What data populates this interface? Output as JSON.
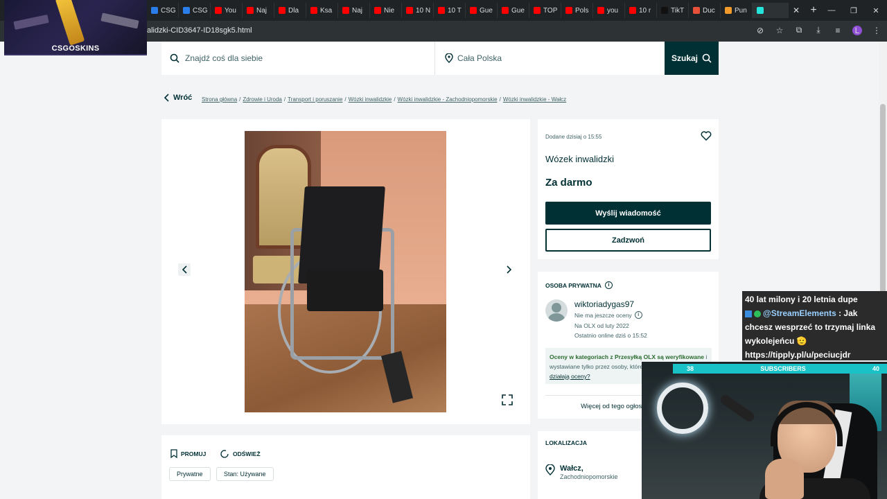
{
  "browser": {
    "tabs": [
      {
        "label": "CSG",
        "color": "#2b7de9"
      },
      {
        "label": "CSG",
        "color": "#2b7de9"
      },
      {
        "label": "You",
        "color": "#ff0000"
      },
      {
        "label": "Naj",
        "color": "#ff0000"
      },
      {
        "label": "Dla",
        "color": "#ff0000"
      },
      {
        "label": "Ksa",
        "color": "#ff0000"
      },
      {
        "label": "Naj",
        "color": "#ff0000"
      },
      {
        "label": "Nie",
        "color": "#ff0000"
      },
      {
        "label": "10 N",
        "color": "#ff0000"
      },
      {
        "label": "10 T",
        "color": "#ff0000"
      },
      {
        "label": "Gue",
        "color": "#ff0000"
      },
      {
        "label": "Gue",
        "color": "#ff0000"
      },
      {
        "label": "TOP",
        "color": "#ff0000"
      },
      {
        "label": "Pols",
        "color": "#ff0000"
      },
      {
        "label": "you",
        "color": "#ff0000"
      },
      {
        "label": "10 r",
        "color": "#ff0000"
      },
      {
        "label": "TikT",
        "color": "#111111"
      },
      {
        "label": "Duc",
        "color": "#e8503a"
      },
      {
        "label": "Pun",
        "color": "#f29b2b"
      },
      {
        "label": "",
        "color": "#23e5db"
      }
    ],
    "close_tab": "✕",
    "new_tab": "+",
    "url": "alidzki-CID3647-ID18sgk5.html",
    "profile_initial": "L",
    "window": {
      "minimize": "—",
      "restore": "❐",
      "close": "✕"
    }
  },
  "overlay": {
    "csg_logo": "CSGOSKINS",
    "chat_lines": [
      "40 lat milony i 20 letnia dupe",
      "@StreamElements",
      " : Jak chcesz wesprzeć to trzymaj linka wykolejeńcu 🫡 https://tipply.pl/u/peciucjdr"
    ],
    "subs": {
      "left": "38",
      "label": "SUBSCRIBERS",
      "right": "40"
    }
  },
  "search": {
    "placeholder": "Znajdź coś dla siebie",
    "location": "Cała Polska",
    "button": "Szukaj"
  },
  "breadcrumbs": {
    "back": "Wróć",
    "items": [
      "Strona główna",
      "Zdrowie i Uroda",
      "Transport i poruszanie",
      "Wózki inwalidzkie",
      "Wózki inwalidzkie - Zachodniopomorskie",
      "Wózki inwalidzkie - Wałcz"
    ],
    "separator": "/"
  },
  "listing": {
    "posted": "Dodane dzisiaj o 15:55",
    "title": "Wózek inwalidzki",
    "price": "Za darmo",
    "send_message": "Wyślij wiadomość",
    "call": "Zadzwoń"
  },
  "seller": {
    "type": "OSOBA PRYWATNA",
    "name": "wiktoriadygas97",
    "rating": "Nie ma jeszcze oceny",
    "since": "Na OLX od luty 2022",
    "online": "Ostatnio online dziś o 15:52",
    "ratings_bold": "Oceny w kategoriach z Przesyłką OLX są weryfikowane",
    "ratings_rest": " i wystawiane tylko przez osoby, które kupiły przedmiot. ",
    "ratings_link": "Jak działają oceny?",
    "more_ads": "Więcej od tego ogłoszeniodawcy"
  },
  "actions": {
    "promote": "PROMUJ",
    "refresh": "ODŚWIEŻ",
    "tags": [
      "Prywatne",
      "Stan: Używane"
    ]
  },
  "location": {
    "title": "LOKALIZACJA",
    "city": "Wałcz,",
    "region": "Zachodniopomorskie"
  },
  "colors": {
    "primary": "#002f34",
    "background": "#f2f4f5",
    "success": "#2b6b2f"
  }
}
